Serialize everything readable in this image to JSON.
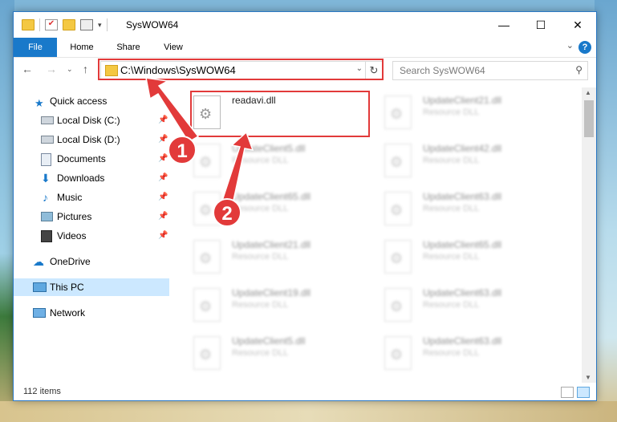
{
  "window": {
    "title": "SysWOW64",
    "minimize": "—",
    "maximize": "☐",
    "close": "✕"
  },
  "ribbon": {
    "tabs": [
      "File",
      "Home",
      "Share",
      "View"
    ],
    "help": "?"
  },
  "nav": {
    "address": "C:\\Windows\\SysWOW64",
    "search_placeholder": "Search SysWOW64"
  },
  "sidebar": {
    "items": [
      {
        "label": "Quick access",
        "icon": "star-icon",
        "pinned": false
      },
      {
        "label": "Local Disk (C:)",
        "icon": "drive-icon",
        "pinned": true
      },
      {
        "label": "Local Disk (D:)",
        "icon": "drive-icon",
        "pinned": true
      },
      {
        "label": "Documents",
        "icon": "documents-icon",
        "pinned": true
      },
      {
        "label": "Downloads",
        "icon": "download-icon",
        "pinned": true
      },
      {
        "label": "Music",
        "icon": "music-icon",
        "pinned": true
      },
      {
        "label": "Pictures",
        "icon": "pictures-icon",
        "pinned": true
      },
      {
        "label": "Videos",
        "icon": "videos-icon",
        "pinned": true
      },
      {
        "label": "OneDrive",
        "icon": "cloud-icon",
        "pinned": false
      },
      {
        "label": "This PC",
        "icon": "computer-icon",
        "pinned": false,
        "selected": true
      },
      {
        "label": "Network",
        "icon": "network-icon",
        "pinned": false
      }
    ]
  },
  "files": {
    "selected": {
      "name": "readavi.dll",
      "type": ""
    },
    "left": [
      {
        "name": "UpdateClient5.dll",
        "type": "Resource DLL"
      },
      {
        "name": "UpdateClient65.dll",
        "type": "Resource DLL"
      },
      {
        "name": "UpdateClient21.dll",
        "type": "Resource DLL"
      },
      {
        "name": "UpdateClient19.dll",
        "type": "Resource DLL"
      },
      {
        "name": "UpdateClient5.dll",
        "type": "Resource DLL"
      }
    ],
    "right": [
      {
        "name": "UpdateClient21.dll",
        "type": "Resource DLL"
      },
      {
        "name": "UpdateClient42.dll",
        "type": "Resource DLL"
      },
      {
        "name": "UpdateClient63.dll",
        "type": "Resource DLL"
      },
      {
        "name": "UpdateClient65.dll",
        "type": "Resource DLL"
      },
      {
        "name": "UpdateClient63.dll",
        "type": "Resource DLL"
      },
      {
        "name": "UpdateClient63.dll",
        "type": "Resource DLL"
      }
    ]
  },
  "status": {
    "count": "112 items"
  },
  "annotations": {
    "step1": "1",
    "step2": "2",
    "color": "#e23a3a"
  }
}
